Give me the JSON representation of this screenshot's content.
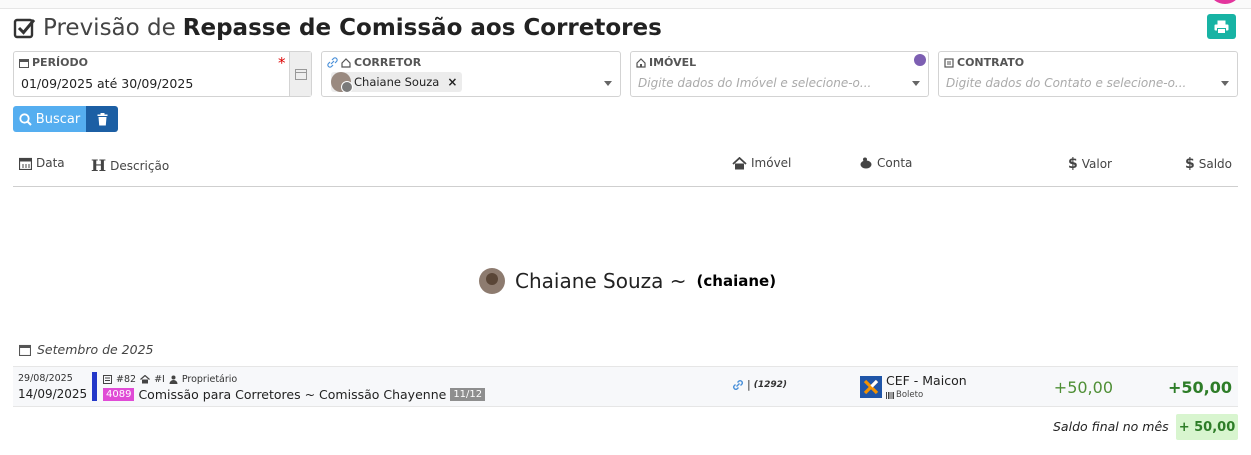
{
  "title": {
    "light": "Previsão de",
    "bold": "Repasse de Comissão aos Corretores"
  },
  "filters": {
    "periodo": {
      "label": "PERÍODO",
      "value": "01/09/2025 até 30/09/2025",
      "required_mark": "*"
    },
    "corretor": {
      "label": "CORRETOR",
      "chip": "Chaiane Souza",
      "chip_remove": "×"
    },
    "imovel": {
      "label": "IMÓVEL",
      "placeholder": "Digite dados do Imóvel e selecione-o..."
    },
    "contrato": {
      "label": "CONTRATO",
      "placeholder": "Digite dados do Contato e selecione-o..."
    }
  },
  "actions": {
    "buscar": "Buscar"
  },
  "table": {
    "headers": {
      "data": "Data",
      "descricao": "Descrição",
      "imovel": "Imóvel",
      "conta": "Conta",
      "valor": "Valor",
      "saldo": "Saldo"
    }
  },
  "person": {
    "name": "Chaiane Souza ~",
    "username": "(chaiane)"
  },
  "month": "Setembro de 2025",
  "rows": [
    {
      "date1": "29/08/2025",
      "date2": "14/09/2025",
      "meta_contract": "#82",
      "meta_imovel": "#I",
      "meta_role": "Proprietário",
      "code": "4089",
      "description": "Comissão para Corretores ~ Comissão Chayenne",
      "installment": "11/12",
      "imovel_sep": "|",
      "imovel_code": "(1292)",
      "conta_name": "CEF - Maicon",
      "conta_type": "Boleto",
      "valor": "+50,00",
      "saldo": "+50,00"
    }
  ],
  "final": {
    "label": "Saldo final no mês",
    "value": "+ 50,00"
  },
  "colors": {
    "accent": "#55aef0",
    "print": "#17b3a4",
    "trash": "#1c5fa4",
    "positive": "#2e7d28",
    "bar": "#2438c9",
    "badge": "#e04bd6"
  }
}
